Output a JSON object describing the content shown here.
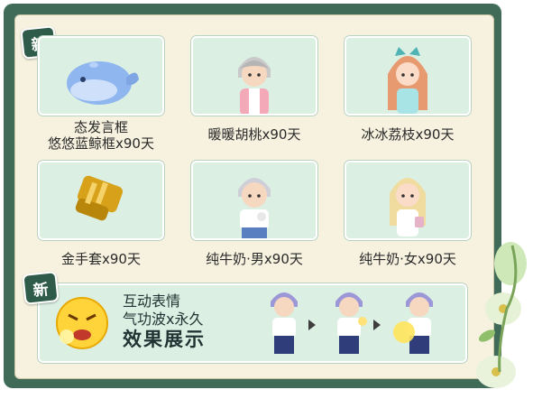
{
  "badges": {
    "top": "新",
    "bottom": "新"
  },
  "items": [
    {
      "label_line1": "态发言框",
      "label_line2": "悠悠蓝鲸框x90天",
      "icon": "whale-icon"
    },
    {
      "label": "暖暖胡桃x90天",
      "icon": "avatar-boy-icon"
    },
    {
      "label": "冰冰荔枝x90天",
      "icon": "avatar-girl-icon"
    },
    {
      "label": "金手套x90天",
      "icon": "gold-glove-icon"
    },
    {
      "label": "纯牛奶·男x90天",
      "icon": "avatar-boy-icon"
    },
    {
      "label": "纯牛奶·女x90天",
      "icon": "avatar-girl-icon"
    }
  ],
  "banner": {
    "line1": "互动表情",
    "line2": "气功波x永久",
    "line3": "效果展示",
    "icon": "angry-emoji-icon"
  },
  "colors": {
    "frame": "#3f6b58",
    "panel": "#f6f2df",
    "card": "#dcefe3",
    "badge": "#2f5b4b"
  }
}
